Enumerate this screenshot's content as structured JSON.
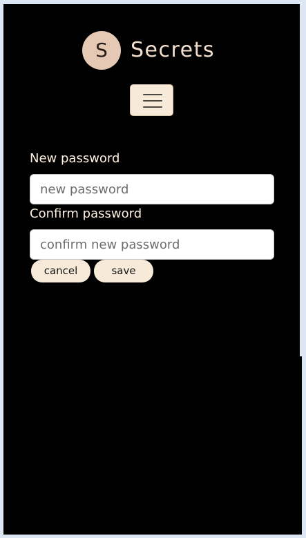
{
  "brand": {
    "logo_letter": "S",
    "name": "Secrets",
    "logo_color": "#e5c9b5",
    "text_color": "#f3dfcd"
  },
  "nav": {
    "menu_icon": "hamburger-menu-icon"
  },
  "form": {
    "new_password_label": "New password",
    "new_password_placeholder": "new password",
    "new_password_value": "",
    "confirm_password_label": "Confirm password",
    "confirm_password_placeholder": "confirm new password",
    "confirm_password_value": ""
  },
  "actions": {
    "cancel_label": "cancel",
    "save_label": "save",
    "button_color": "#f8ead8"
  },
  "theme": {
    "page_background": "#000000",
    "outer_background": "#dde7f3"
  }
}
